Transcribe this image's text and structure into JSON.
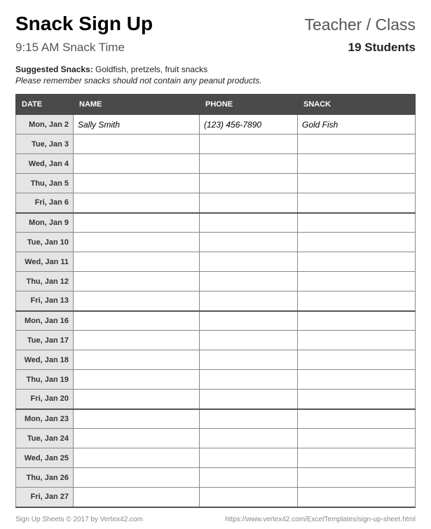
{
  "header": {
    "title": "Snack Sign Up",
    "teacher_class": "Teacher / Class",
    "snack_time": "9:15 AM Snack Time",
    "students": "19 Students",
    "suggested_label": "Suggested Snacks:",
    "suggested_value": "Goldfish, pretzels, fruit snacks",
    "note": "Please remember snacks should not contain any peanut products."
  },
  "columns": {
    "date": "DATE",
    "name": "NAME",
    "phone": "PHONE",
    "snack": "SNACK"
  },
  "rows": [
    {
      "date": "Mon, Jan 2",
      "name": "Sally Smith",
      "phone": "(123) 456-7890",
      "snack": "Gold Fish",
      "week_end": false
    },
    {
      "date": "Tue, Jan 3",
      "name": "",
      "phone": "",
      "snack": "",
      "week_end": false
    },
    {
      "date": "Wed, Jan 4",
      "name": "",
      "phone": "",
      "snack": "",
      "week_end": false
    },
    {
      "date": "Thu, Jan 5",
      "name": "",
      "phone": "",
      "snack": "",
      "week_end": false
    },
    {
      "date": "Fri, Jan 6",
      "name": "",
      "phone": "",
      "snack": "",
      "week_end": true
    },
    {
      "date": "Mon, Jan 9",
      "name": "",
      "phone": "",
      "snack": "",
      "week_end": false
    },
    {
      "date": "Tue, Jan 10",
      "name": "",
      "phone": "",
      "snack": "",
      "week_end": false
    },
    {
      "date": "Wed, Jan 11",
      "name": "",
      "phone": "",
      "snack": "",
      "week_end": false
    },
    {
      "date": "Thu, Jan 12",
      "name": "",
      "phone": "",
      "snack": "",
      "week_end": false
    },
    {
      "date": "Fri, Jan 13",
      "name": "",
      "phone": "",
      "snack": "",
      "week_end": true
    },
    {
      "date": "Mon, Jan 16",
      "name": "",
      "phone": "",
      "snack": "",
      "week_end": false
    },
    {
      "date": "Tue, Jan 17",
      "name": "",
      "phone": "",
      "snack": "",
      "week_end": false
    },
    {
      "date": "Wed, Jan 18",
      "name": "",
      "phone": "",
      "snack": "",
      "week_end": false
    },
    {
      "date": "Thu, Jan 19",
      "name": "",
      "phone": "",
      "snack": "",
      "week_end": false
    },
    {
      "date": "Fri, Jan 20",
      "name": "",
      "phone": "",
      "snack": "",
      "week_end": true
    },
    {
      "date": "Mon, Jan 23",
      "name": "",
      "phone": "",
      "snack": "",
      "week_end": false
    },
    {
      "date": "Tue, Jan 24",
      "name": "",
      "phone": "",
      "snack": "",
      "week_end": false
    },
    {
      "date": "Wed, Jan 25",
      "name": "",
      "phone": "",
      "snack": "",
      "week_end": false
    },
    {
      "date": "Thu, Jan 26",
      "name": "",
      "phone": "",
      "snack": "",
      "week_end": false
    },
    {
      "date": "Fri, Jan 27",
      "name": "",
      "phone": "",
      "snack": "",
      "week_end": true
    }
  ],
  "footer": {
    "left": "Sign Up Sheets © 2017 by Vertex42.com",
    "right": "https://www.vertex42.com/ExcelTemplates/sign-up-sheet.html"
  }
}
